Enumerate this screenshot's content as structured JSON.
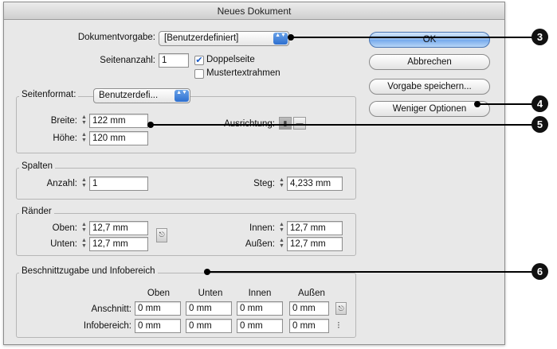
{
  "window": {
    "title": "Neues Dokument"
  },
  "top": {
    "preset_label": "Dokumentvorgabe:",
    "preset_value": "[Benutzerdefiniert]",
    "pages_label": "Seitenanzahl:",
    "pages_value": "1",
    "facing_pages_label": "Doppelseite",
    "facing_pages_checked": true,
    "master_frame_label": "Mustertextrahmen",
    "master_frame_checked": false
  },
  "buttons": {
    "ok": "OK",
    "cancel": "Abbrechen",
    "save_preset": "Vorgabe speichern...",
    "fewer_options": "Weniger Optionen"
  },
  "page_size": {
    "label": "Seitenformat:",
    "value": "Benutzerdefi...",
    "width_label": "Breite:",
    "width_value": "122 mm",
    "height_label": "Höhe:",
    "height_value": "120 mm",
    "orientation_label": "Ausrichtung:"
  },
  "columns": {
    "title": "Spalten",
    "count_label": "Anzahl:",
    "count_value": "1",
    "gutter_label": "Steg:",
    "gutter_value": "4,233 mm"
  },
  "margins": {
    "title": "Ränder",
    "top_label": "Oben:",
    "top_value": "12,7 mm",
    "bottom_label": "Unten:",
    "bottom_value": "12,7 mm",
    "inside_label": "Innen:",
    "inside_value": "12,7 mm",
    "outside_label": "Außen:",
    "outside_value": "12,7 mm"
  },
  "bleed": {
    "title": "Beschnittzugabe und Infobereich",
    "col_top": "Oben",
    "col_bottom": "Unten",
    "col_inside": "Innen",
    "col_outside": "Außen",
    "bleed_label": "Anschnitt:",
    "bleed_values": [
      "0 mm",
      "0 mm",
      "0 mm",
      "0 mm"
    ],
    "slug_label": "Infobereich:",
    "slug_values": [
      "0 mm",
      "0 mm",
      "0 mm",
      "0 mm"
    ]
  },
  "callouts": [
    "3",
    "4",
    "5",
    "6"
  ]
}
